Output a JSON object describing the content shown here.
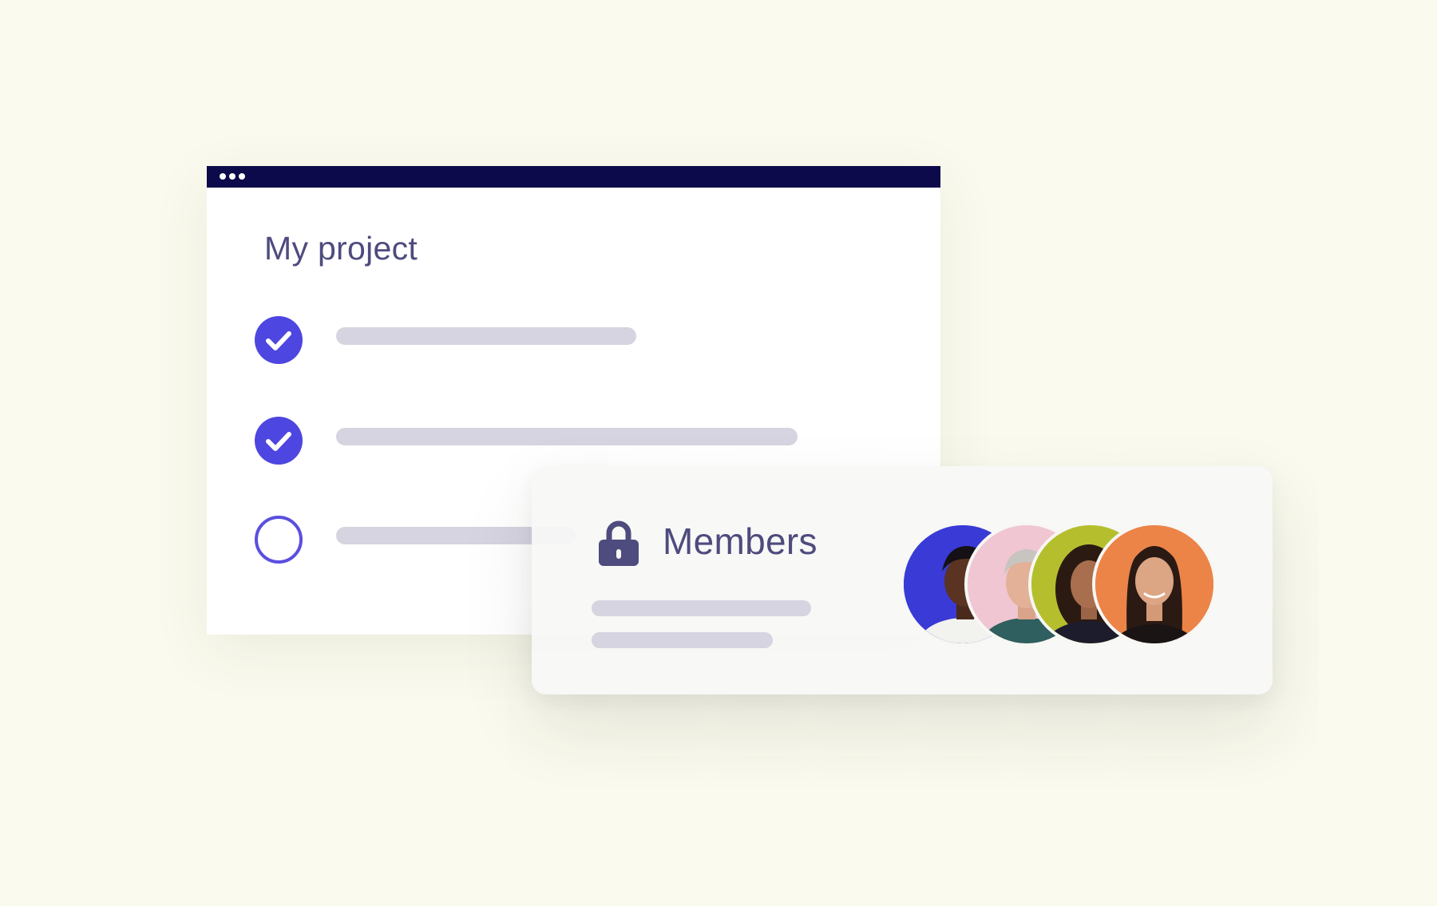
{
  "project_window": {
    "title": "My project",
    "tasks": [
      {
        "status": "done"
      },
      {
        "status": "done"
      },
      {
        "status": "open"
      }
    ]
  },
  "members_card": {
    "title": "Members",
    "icon": "lock-icon",
    "avatars": [
      {
        "background": "#3a3ad6"
      },
      {
        "background": "#f0c6d2"
      },
      {
        "background": "#b5bf2e"
      },
      {
        "background": "#ec8448"
      }
    ]
  },
  "colors": {
    "page_background": "#fafaee",
    "title_bar": "#0c0a4a",
    "accent": "#4e46e0",
    "heading_text": "#4e4b7e",
    "placeholder_bar": "#d5d4e0"
  }
}
